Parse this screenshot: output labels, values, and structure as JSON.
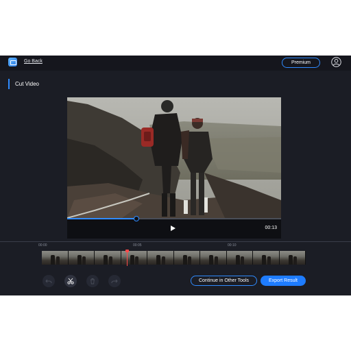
{
  "header": {
    "go_back_label": "Go Back",
    "premium_label": "Premium"
  },
  "page": {
    "title": "Cut Video"
  },
  "player": {
    "time": "00:13",
    "progress": 0.32
  },
  "timeline": {
    "ticks": [
      "00:00",
      "00:05",
      "00:10"
    ],
    "frame_count": 10,
    "playhead_position": 0.32
  },
  "tools": {
    "undo_icon": "undo-icon",
    "cut_icon": "scissors-icon",
    "delete_icon": "trash-icon",
    "redo_icon": "redo-icon"
  },
  "actions": {
    "continue_label": "Continue in Other Tools",
    "export_label": "Export Result"
  },
  "colors": {
    "accent": "#2f8bff",
    "background": "#1b1d25",
    "playhead": "#ff4a4a"
  }
}
